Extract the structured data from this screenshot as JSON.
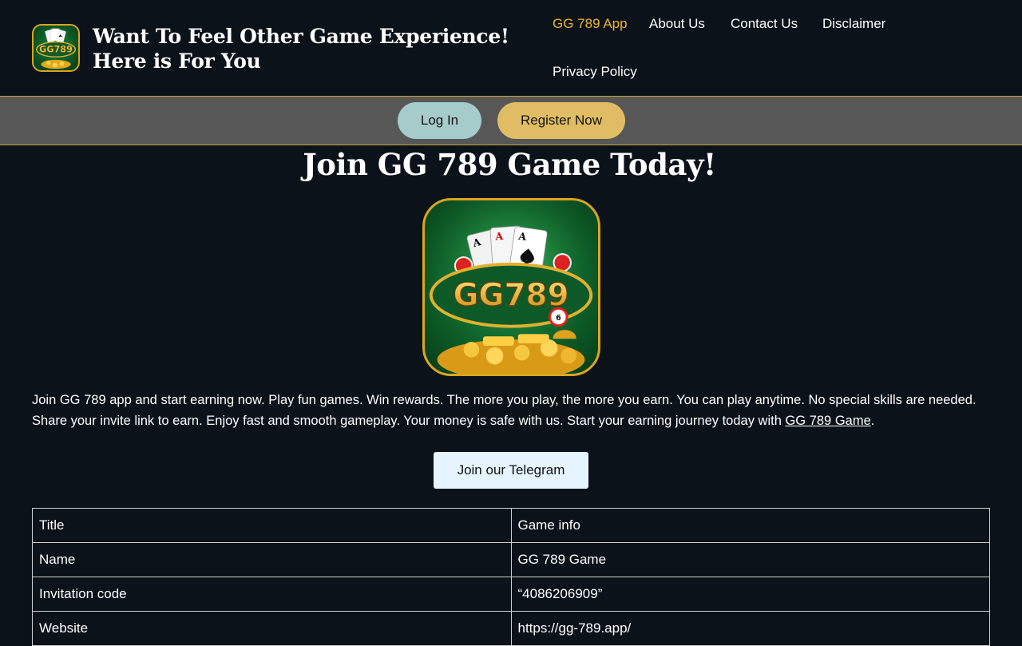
{
  "header": {
    "site_title": "Want To Feel Other Game Experience! Here is For You",
    "logo_icon": "gg789-logo-icon",
    "nav": [
      {
        "label": "GG 789 App",
        "active": true
      },
      {
        "label": "About Us",
        "active": false
      },
      {
        "label": "Contact Us",
        "active": false
      },
      {
        "label": "Disclaimer",
        "active": false
      },
      {
        "label": "Privacy Policy",
        "active": false
      }
    ]
  },
  "auth": {
    "login_label": "Log In",
    "register_label": "Register Now"
  },
  "main": {
    "title": "Join GG 789 Game Today!",
    "hero_logo_text": "GG789",
    "intro_text": "Join GG 789 app and start earning now. Play fun games. Win rewards. The more you play, the more you earn. You can play anytime. No special skills are needed. Share your invite link to earn. Enjoy fast and smooth gameplay. Your money is safe with us. Start your earning journey today with ",
    "intro_link": "GG 789 Game",
    "intro_end": ".",
    "telegram_label": "Join our Telegram"
  },
  "table": {
    "rows": [
      [
        "Title",
        "Game info"
      ],
      [
        "Name",
        "GG 789 Game"
      ],
      [
        "Invitation code",
        "“4086206909”"
      ],
      [
        "Website",
        "https://gg-789.app/"
      ]
    ]
  },
  "colors": {
    "background": "#0b121a",
    "nav_active": "#f0b429",
    "auth_bar": "#575757",
    "login_button": "#a6cbcb",
    "register_button": "#e0bd64",
    "telegram_button": "#e6f4ff"
  }
}
